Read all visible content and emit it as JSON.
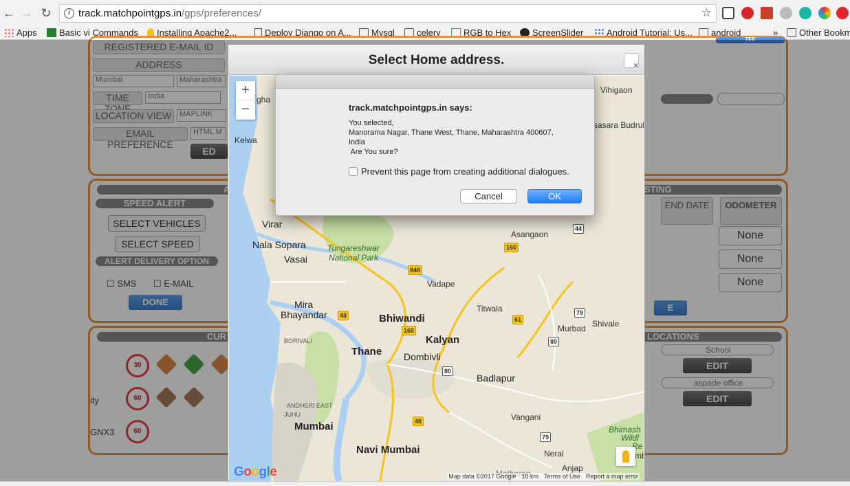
{
  "browser": {
    "url_host": "track.matchpointgps.in",
    "url_path": "/gps/preferences/",
    "bookmarks": [
      "Apps",
      "Basic vi Commands",
      "Installing Apache2...",
      "Deploy Django on A...",
      "Mysql",
      "celery",
      "RGB to Hex",
      "ScreenSlider",
      "Android Tutorial: Us...",
      "android",
      "Other Bookm"
    ],
    "overflow": "»"
  },
  "page": {
    "registered_email": "REGISTERED E-MAIL ID",
    "address": "ADDRESS",
    "city": "Mumbai",
    "state": "Maharashtra",
    "timezone_label": "TIME ZONE",
    "timezone_value": "India",
    "location_view_label": "LOCATION VIEW",
    "location_view_value": "MAPLINK",
    "email_pref_label": "EMAIL PREFERENCE",
    "email_pref_value": "HTML M",
    "edit_partial": "ED",
    "alerts_header_partial": "A",
    "speed_alert": "SPEED ALERT",
    "select_vehicles": "SELECT VEHICLES",
    "select_speed": "SELECT SPEED",
    "alert_delivery": "ALERT DELIVERY OPTION",
    "sms": "SMS",
    "email": "E-MAIL",
    "done": "DONE",
    "listing_partial": "STING",
    "end_date": "END DATE",
    "odometer": "ODOMETER",
    "none": "None",
    "e_partial": "E",
    "cur_partial": "CUR",
    "locations_partial": "LOCATIONS",
    "loc1": "School",
    "loc2": "aspade office",
    "edit": "EDIT",
    "speed_30": "30",
    "speed_60": "60",
    "ity_partial": "ity",
    "gnx3_partial": "GNX3",
    "top_right_partial": "TEE"
  },
  "modal": {
    "title": "Select Home address.",
    "map": {
      "places": {
        "vihigaon": "Vihigaon",
        "kelwa": "Kelwa",
        "sasara": "sasara Budruk",
        "virar": "Virar",
        "nala": "Nala Sopara",
        "vasai": "Vasai",
        "tungareshwar": "Tungareshwar",
        "national_park": "National Park",
        "asangaon": "Asangaon",
        "vadape": "Vadape",
        "titwala": "Titwala",
        "mira": "Mira",
        "bhayandar": "Bhayandar",
        "bhiwandi": "Bhiwandi",
        "murbad": "Murbad",
        "shivale": "Shivale",
        "kalyan": "Kalyan",
        "thane": "Thane",
        "dombivli": "Dombivli",
        "badlapur": "Badlapur",
        "borivali": "BORIVALI",
        "andheri": "ANDHERI EAST",
        "juhu": "JUHU",
        "mumbai": "Mumbai",
        "vangani": "Vangani",
        "navi_mumbai": "Navi Mumbai",
        "neral": "Neral",
        "anjap": "Anjap",
        "matheran": "Matheran",
        "bhimash": "Bhimash",
        "wildl": "Wildl",
        "gha": "gha",
        "re": "Re",
        "mb": "mb"
      },
      "shields": [
        "44",
        "160",
        "848",
        "48",
        "61",
        "79",
        "80",
        "160",
        "80",
        "48",
        "79"
      ],
      "zoom_in": "+",
      "zoom_out": "−",
      "google": "Google",
      "attribution": {
        "map_data": "Map data ©2017 Google",
        "scale": "10 km",
        "terms": "Terms of Use",
        "report": "Report a map error"
      }
    }
  },
  "dialog": {
    "title": "track.matchpointgps.in says:",
    "message": "You selected,\nManorama Nagar, Thane West, Thane, Maharashtra 400607,\nIndia\n Are You sure?",
    "checkbox": "Prevent this page from creating additional dialogues.",
    "cancel": "Cancel",
    "ok": "OK"
  },
  "colors": {
    "panel_border": "#e8913c",
    "ok_button": "#1c7ef5",
    "map_land": "#ece6d8",
    "map_water": "#abd0f2",
    "map_park": "#c8dfa5"
  }
}
